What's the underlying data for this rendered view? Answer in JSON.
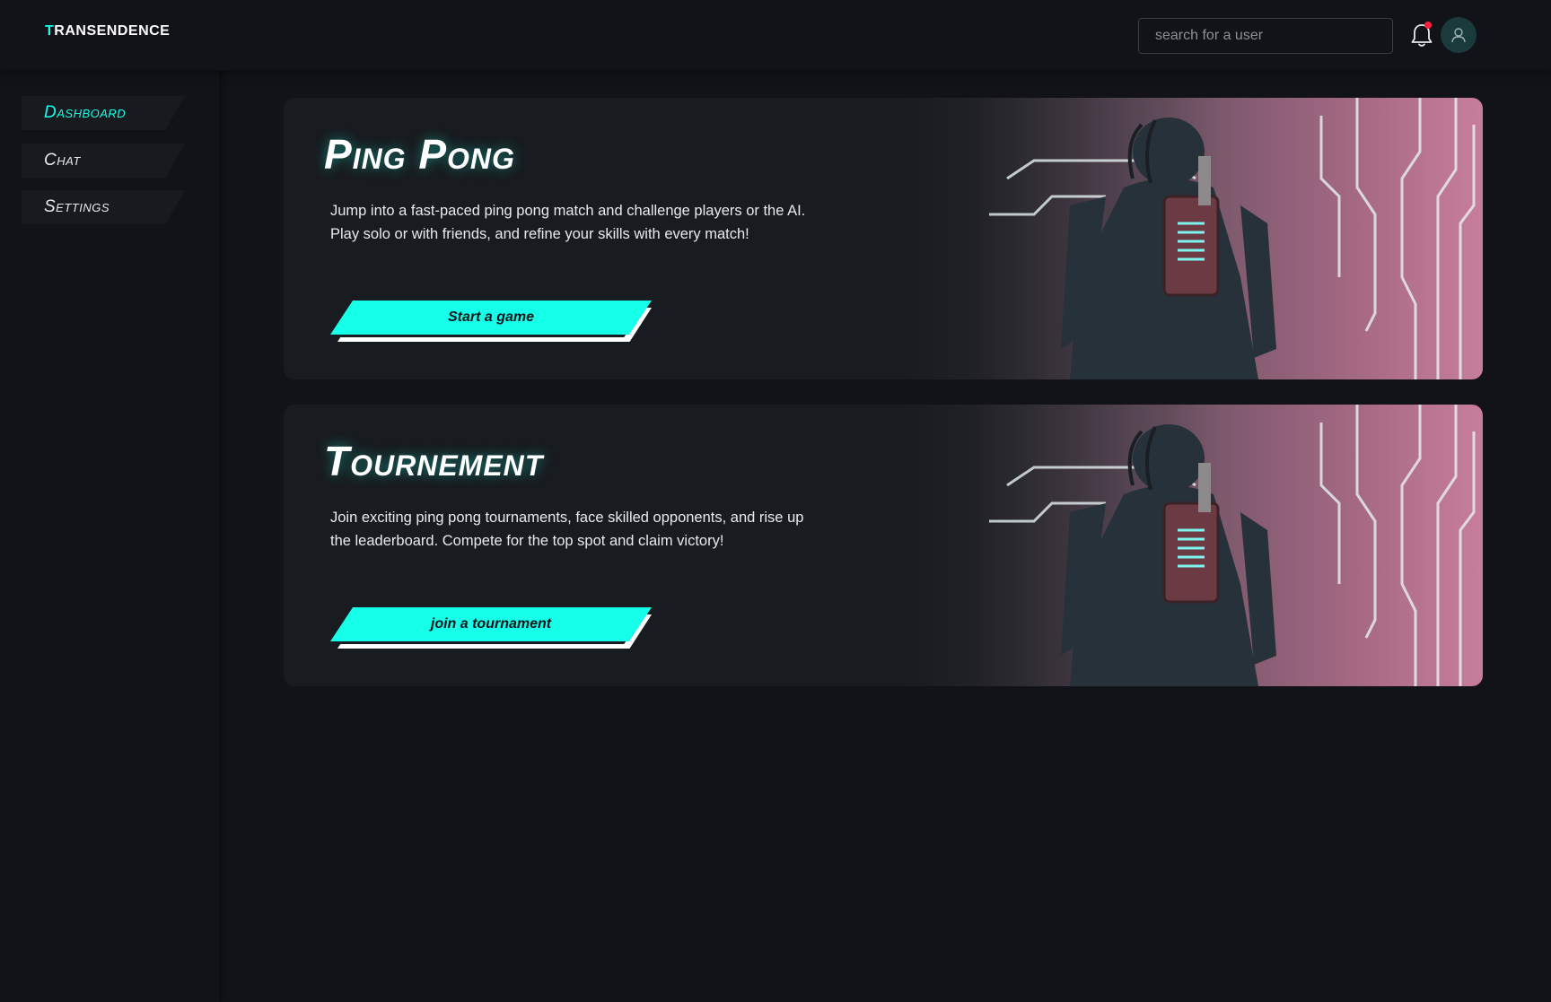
{
  "app": {
    "logo_accent": "T",
    "logo_rest": "RANSENDENCE"
  },
  "header": {
    "search_placeholder": "search for a user",
    "notification_badge_color": "#ff1f3d"
  },
  "sidebar": {
    "items": [
      {
        "label": "Dashboard",
        "active": true
      },
      {
        "label": "Chat",
        "active": false
      },
      {
        "label": "Settings",
        "active": false
      }
    ]
  },
  "cards": [
    {
      "title": "Ping Pong",
      "description": "Jump into a fast-paced ping pong match and challenge players or the AI. Play solo or with friends, and refine your skills with every match!",
      "button_label": "Start a game"
    },
    {
      "title": "Tournement",
      "description": "Join exciting ping pong tournaments, face skilled opponents, and rise up the leaderboard. Compete for the top spot and claim victory!",
      "button_label": "join a tournament"
    }
  ],
  "theme": {
    "accent": "#16ffe8",
    "background": "#111318",
    "card_background": "#181b1f"
  }
}
